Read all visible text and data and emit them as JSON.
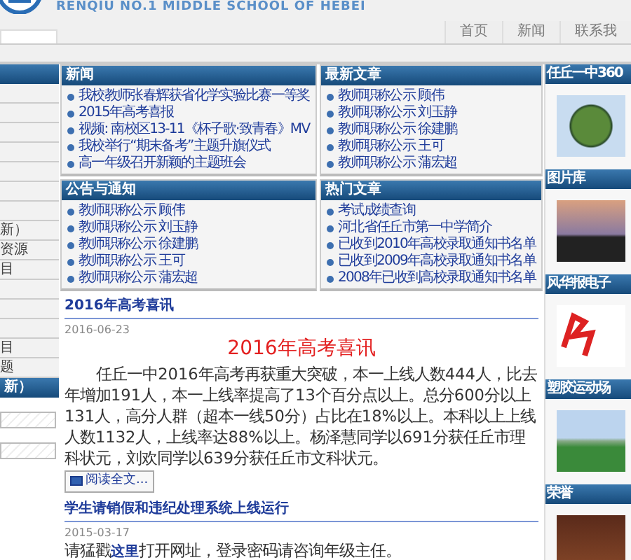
{
  "header": {
    "school_name_en": "RENQIU NO.1 MIDDLE SCHOOL OF HEBEI",
    "nav": [
      {
        "label": "首页"
      },
      {
        "label": "新闻"
      },
      {
        "label": "联系我"
      }
    ]
  },
  "left_sidebar": {
    "rows": [
      {
        "kind": "blank"
      },
      {
        "kind": "blank"
      },
      {
        "kind": "blank"
      },
      {
        "kind": "blank"
      },
      {
        "kind": "blank"
      },
      {
        "kind": "blank"
      },
      {
        "kind": "blank"
      },
      {
        "kind": "text",
        "label": "新）"
      },
      {
        "kind": "text",
        "label": "资源"
      },
      {
        "kind": "text",
        "label": "目"
      },
      {
        "kind": "blank"
      },
      {
        "kind": "blank"
      },
      {
        "kind": "blank"
      },
      {
        "kind": "text",
        "label": "目"
      },
      {
        "kind": "text",
        "label": "题"
      }
    ],
    "section_title": "新）"
  },
  "panels": [
    {
      "title": "新闻",
      "items": [
        "我校教师张春辉获省化学实验比赛一等奖",
        "2015年高考喜报",
        "视频: 南校区13-11《杯子歌·致青春》MV",
        "我校举行“期末备考”主题升旗仪式",
        "高一年级召开新颖的主题班会"
      ]
    },
    {
      "title": "最新文章",
      "items": [
        "教师职称公示 顾伟",
        "教师职称公示 刘玉静",
        "教师职称公示 徐建鹏",
        "教师职称公示 王可",
        "教师职称公示 蒲宏超"
      ]
    },
    {
      "title": "公告与通知",
      "items": [
        "教师职称公示 顾伟",
        "教师职称公示 刘玉静",
        "教师职称公示 徐建鹏",
        "教师职称公示 王可",
        "教师职称公示 蒲宏超"
      ]
    },
    {
      "title": "热门文章",
      "items": [
        "考试成绩查询",
        "河北省任丘市第一中学简介",
        "已收到2010年高校录取通知书名单",
        "已收到2009年高校录取通知书名单",
        "2008年已收到高校录取通知书名单"
      ]
    }
  ],
  "articles": [
    {
      "title": "2016年高考喜讯",
      "date": "2016-06-23",
      "headline": "2016年高考喜讯",
      "body": "任丘一中2016年高考再获重大突破，本一上线人数444人，比去年增加191人，本一上线率提高了13个百分点以上。总分600分以上131人，高分人群（超本一线50分）占比在18%以上。本科以上上线人数1132人，上线率达88%以上。杨泽慧同学以691分获任丘市理科状元，刘欢同学以639分获任丘市文科状元。",
      "read_more": "阅读全文..."
    },
    {
      "title": "学生请销假和违纪处理系统上线运行",
      "date": "2015-03-17",
      "body_before": "请猛戳",
      "link": "这里",
      "body_after": "打开网址，登录密码请咨询年级主任。"
    }
  ],
  "right_sidebar": [
    {
      "title": "任丘一中360",
      "kind": "globe"
    },
    {
      "title": "图片库",
      "kind": "sunset"
    },
    {
      "title": "风华报电子",
      "kind": "logo"
    },
    {
      "title": "塑胶运动场",
      "kind": "field"
    },
    {
      "title": "荣誉",
      "kind": "plaque"
    }
  ]
}
